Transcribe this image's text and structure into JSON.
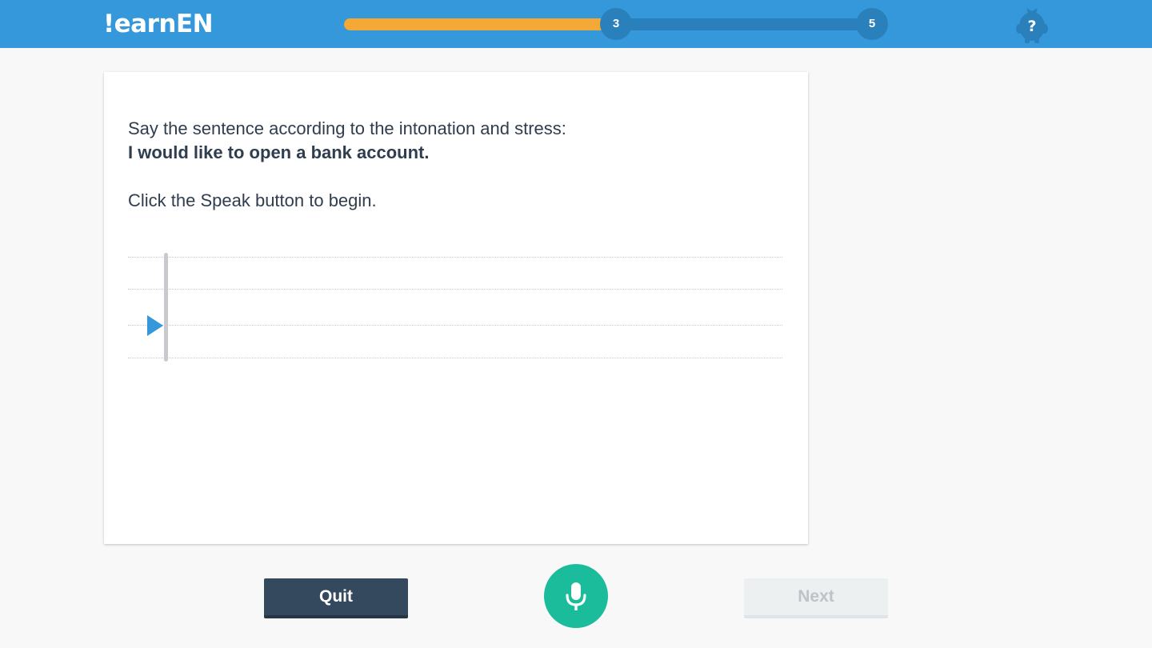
{
  "header": {
    "logo_text": "!earnEN",
    "progress": {
      "fraction": 0.5,
      "current_step": "3",
      "total_steps": "5"
    },
    "help_icon": "help-mascot-icon",
    "help_symbol": "?"
  },
  "card": {
    "instruction": "Say the sentence according to the intonation and stress:",
    "sentence": "I would like to open a bank account.",
    "hint": "Click the Speak button to begin.",
    "play_icon": "play-icon"
  },
  "footer": {
    "quit_label": "Quit",
    "speak_icon": "microphone-icon",
    "next_label": "Next"
  },
  "colors": {
    "header_bg": "#3498db",
    "progress_fill": "#f4a937",
    "progress_track": "#2a80ba",
    "speak_button": "#1abc9c",
    "quit_button": "#34495e",
    "next_button_disabled": "#ecf0f1",
    "play_icon": "#3498db"
  }
}
